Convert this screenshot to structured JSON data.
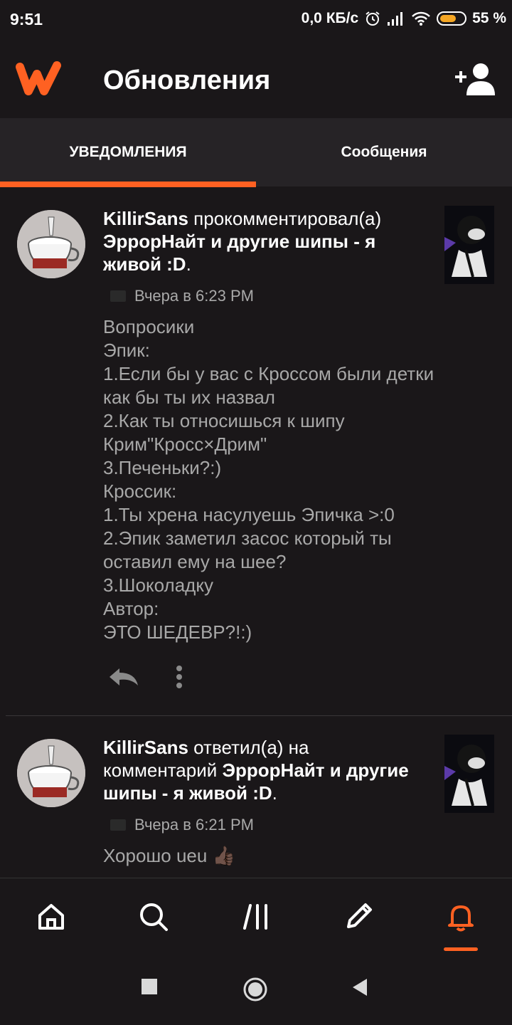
{
  "status": {
    "time": "9:51",
    "net_speed": "0,0 КБ/с",
    "battery": "55 %"
  },
  "header": {
    "title": "Обновления",
    "add_user_icon": "add-user-icon",
    "logo_icon": "wattpad-logo"
  },
  "tabs": [
    {
      "label": "УВЕДОМЛЕНИЯ",
      "active": true
    },
    {
      "label": "Сообщения",
      "active": false
    }
  ],
  "colors": {
    "accent": "#ff6122",
    "background": "#1a1719",
    "tab_bar": "#262326",
    "muted_text": "#a8a8a8"
  },
  "notifications": [
    {
      "user": "KillirSans",
      "action": " прокомментировал(а) ",
      "story": "ЭррорНайт и другие шипы - я живой :D",
      "end": ".",
      "time": "Вчера в 6:23 PM",
      "text": "Вопросики\nЭпик:\n1.Если бы у вас с Кроссом были детки как бы ты их назвал\n2.Как ты относишься к шипу Крим\"Кросс×Дрим\"\n3.Печеньки?:)\nКроссик:\n1.Ты хрена насулуешь Эпичка >:0\n2.Эпик заметил засос который ты оставил ему на шее?\n3.Шоколадку\nАвтор:\nЭТО ШЕДЕВР?!:)"
    },
    {
      "user": "KillirSans",
      "action": " ответил(а) на комментарий ",
      "story": "ЭррорНайт и другие шипы - я живой :D",
      "end": ".",
      "time": "Вчера в 6:21 PM",
      "text": "Хорошо ueu 👍🏿"
    }
  ],
  "bottom_nav": [
    "home-icon",
    "search-icon",
    "library-icon",
    "write-icon",
    "bell-icon"
  ],
  "bottom_nav_active": "bell-icon"
}
